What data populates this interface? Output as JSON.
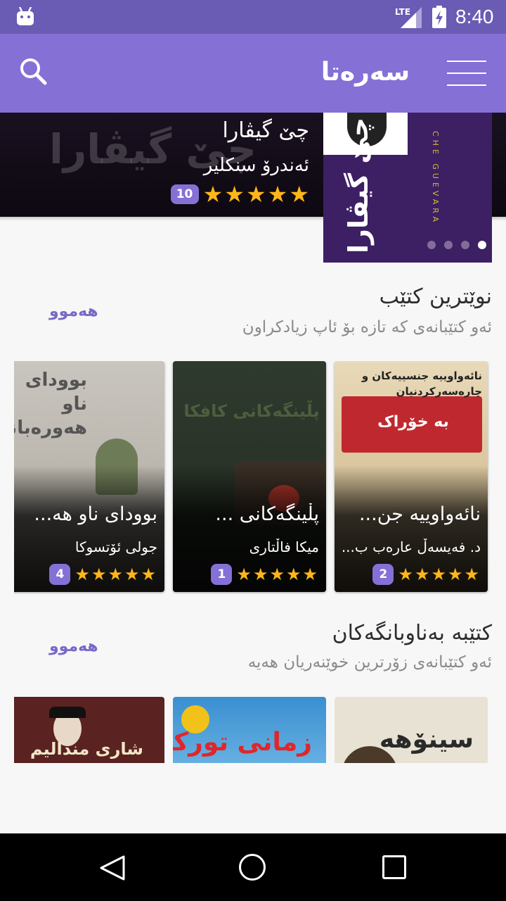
{
  "status_bar": {
    "network": "LTE",
    "time": "8:40"
  },
  "app_bar": {
    "title": "سەرەتا"
  },
  "hero": {
    "ghost_text": "چێ گیڤارا",
    "title": "چێ گیڤارا",
    "author": "ئەندرۆ سنکلیر",
    "rating_count": "10",
    "stars": 5,
    "cover_text": "چێ گیڤارا",
    "cover_latin": "CHE GUEVARA",
    "slides": 4,
    "active_slide": 4
  },
  "latest": {
    "title": "نوێترین کتێب",
    "subtitle": "ئەو کتێبانەی کە تازە بۆ ئاپ زیادکراون",
    "see_all": "هەموو",
    "books": [
      {
        "title": "نائەواوییە جن...",
        "author": "د. فەیسەڵ عارەب ب...",
        "count": "2",
        "stars": 5,
        "cover": "نائەواوییە جنسییەکان و چارەسەرکردنیان",
        "cover_band": "بە خۆراک"
      },
      {
        "title": "پڵینگەکانی ...",
        "author": "میکا فاڵتاری",
        "count": "1",
        "stars": 5,
        "cover": "پڵینگەکانی کافکا",
        "cover_band": ""
      },
      {
        "title": "بوودای ناو هە...",
        "author": "جولی ئۆتسوکا",
        "count": "4",
        "stars": 5,
        "cover": "بوودای ناو هەورەبانەکە",
        "cover_band": ""
      }
    ]
  },
  "popular": {
    "title": "کتێبە بەناوبانگەکان",
    "subtitle": "ئەو کتێبانەی زۆرترین خوێنەریان هەیە",
    "see_all": "هەموو",
    "books": [
      {
        "cover": "سینۆهە"
      },
      {
        "cover": "زمانی تورکی"
      },
      {
        "cover": "شاری مندالیم"
      }
    ]
  },
  "colors": {
    "status_bar": "#6a5bb5",
    "app_bar": "#8570d6",
    "accent": "#8570d6",
    "star": "#ffb619"
  },
  "icons": {
    "search": "search-icon",
    "menu": "menu-icon",
    "back": "back-icon",
    "home": "home-icon",
    "recent": "recent-apps-icon"
  }
}
